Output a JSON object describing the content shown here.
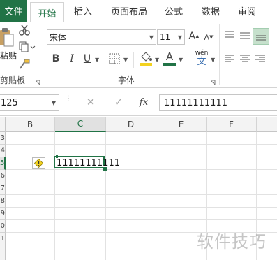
{
  "tabs": {
    "file": "文件",
    "home": "开始",
    "insert": "插入",
    "page_layout": "页面布局",
    "formulas": "公式",
    "data": "数据",
    "review": "审阅"
  },
  "ribbon": {
    "paste_label": "粘贴",
    "clipboard_group": "剪贴板",
    "font_group": "字体",
    "font_name": "宋体",
    "font_size": "11",
    "bold": "B",
    "italic": "I",
    "underline": "U",
    "grow_font": "A",
    "shrink_font": "A",
    "phonetic_label": "wén",
    "phonetic_char": "文"
  },
  "formula_bar": {
    "name_box": "125",
    "fx": "fx",
    "value": "11111111111"
  },
  "sheet": {
    "columns": [
      "B",
      "C",
      "D",
      "E",
      "F"
    ],
    "active_column": "C",
    "rows": [
      "3",
      "4",
      "5",
      "6",
      "7",
      "8",
      "9",
      "0",
      "1"
    ],
    "active_row": "5",
    "cell_value": "11111111111"
  },
  "watermark": "软件技巧",
  "colors": {
    "accent": "#217346",
    "warning": "#f3d21f"
  }
}
